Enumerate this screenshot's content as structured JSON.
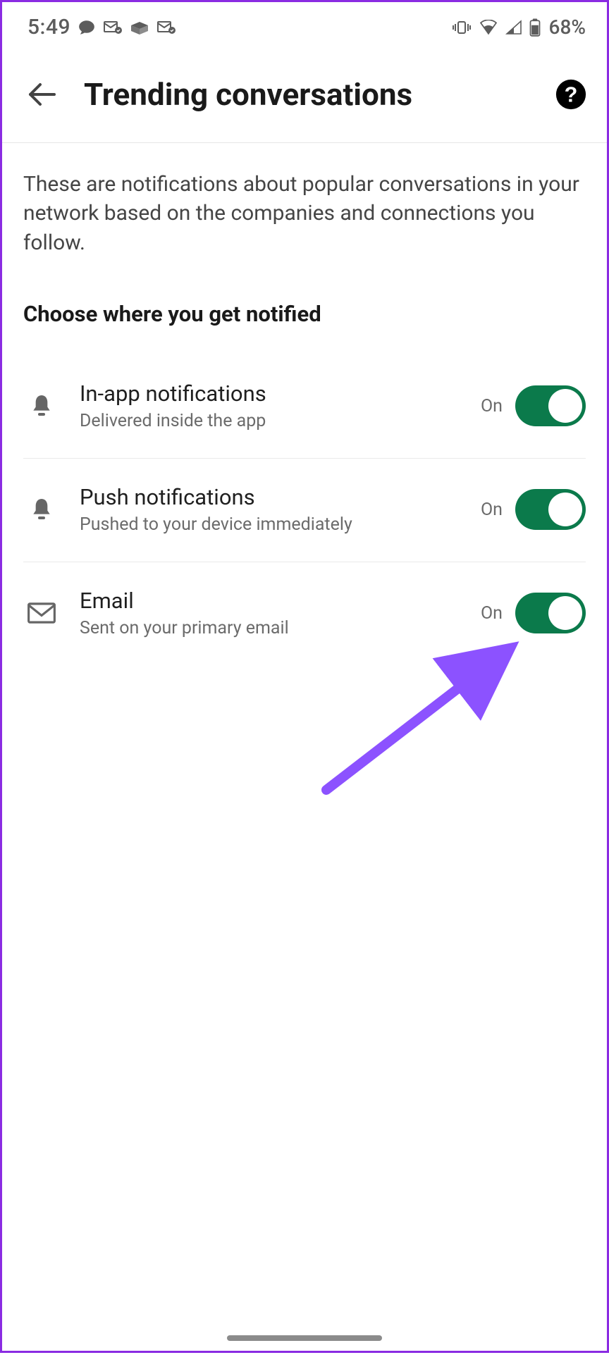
{
  "status": {
    "time": "5:49",
    "battery": "68%"
  },
  "header": {
    "title": "Trending conversations"
  },
  "description": "These are notifications about popular conversations in your network based on the companies and connections you follow.",
  "section_heading": "Choose where you get notified",
  "settings": {
    "inapp": {
      "title": "In-app notifications",
      "subtitle": "Delivered inside the app",
      "state": "On"
    },
    "push": {
      "title": "Push notifications",
      "subtitle": "Pushed to your device immediately",
      "state": "On"
    },
    "email": {
      "title": "Email",
      "subtitle": "Sent on your primary email",
      "state": "On"
    }
  },
  "colors": {
    "toggle_on": "#0b7a4b",
    "annotation_arrow": "#8c52ff",
    "frame_border": "#8a2be2"
  }
}
